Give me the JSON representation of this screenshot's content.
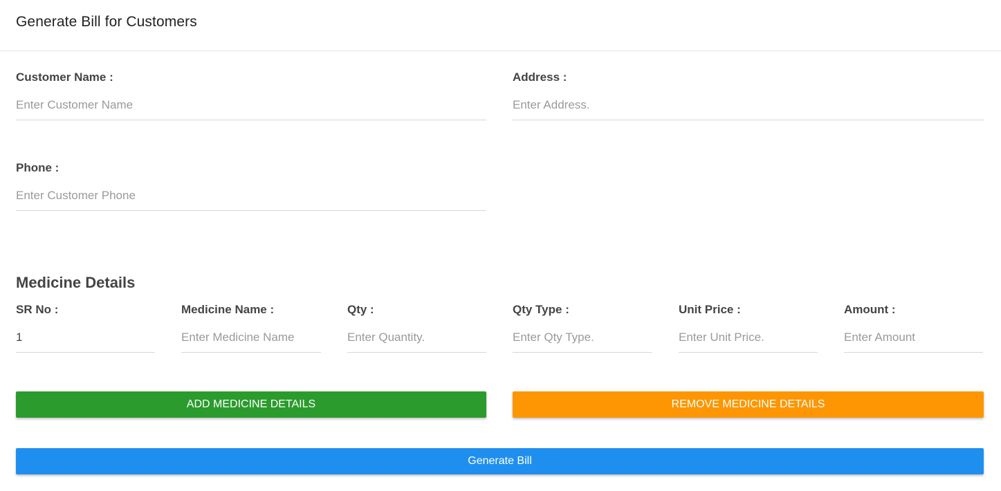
{
  "header": {
    "title": "Generate Bill for Customers"
  },
  "customer": {
    "name": {
      "label": "Customer Name :",
      "placeholder": "Enter Customer Name",
      "value": ""
    },
    "address": {
      "label": "Address :",
      "placeholder": "Enter Address.",
      "value": ""
    },
    "phone": {
      "label": "Phone :",
      "placeholder": "Enter Customer Phone",
      "value": ""
    }
  },
  "medicine": {
    "title": "Medicine Details",
    "fields": [
      {
        "label": "SR No :",
        "placeholder": "",
        "value": "1"
      },
      {
        "label": "Medicine Name :",
        "placeholder": "Enter Medicine Name",
        "value": ""
      },
      {
        "label": "Qty :",
        "placeholder": "Enter Quantity.",
        "value": ""
      },
      {
        "label": "Qty Type :",
        "placeholder": "Enter Qty Type.",
        "value": ""
      },
      {
        "label": "Unit Price :",
        "placeholder": "Enter Unit Price.",
        "value": ""
      },
      {
        "label": "Amount :",
        "placeholder": "Enter Amount",
        "value": ""
      }
    ]
  },
  "buttons": {
    "add": "ADD MEDICINE DETAILS",
    "remove": "REMOVE MEDICINE DETAILS",
    "generate": "Generate Bill"
  },
  "colors": {
    "add_button": "#2b9b2d",
    "remove_button": "#fd9602",
    "generate_button": "#1f8fef"
  }
}
